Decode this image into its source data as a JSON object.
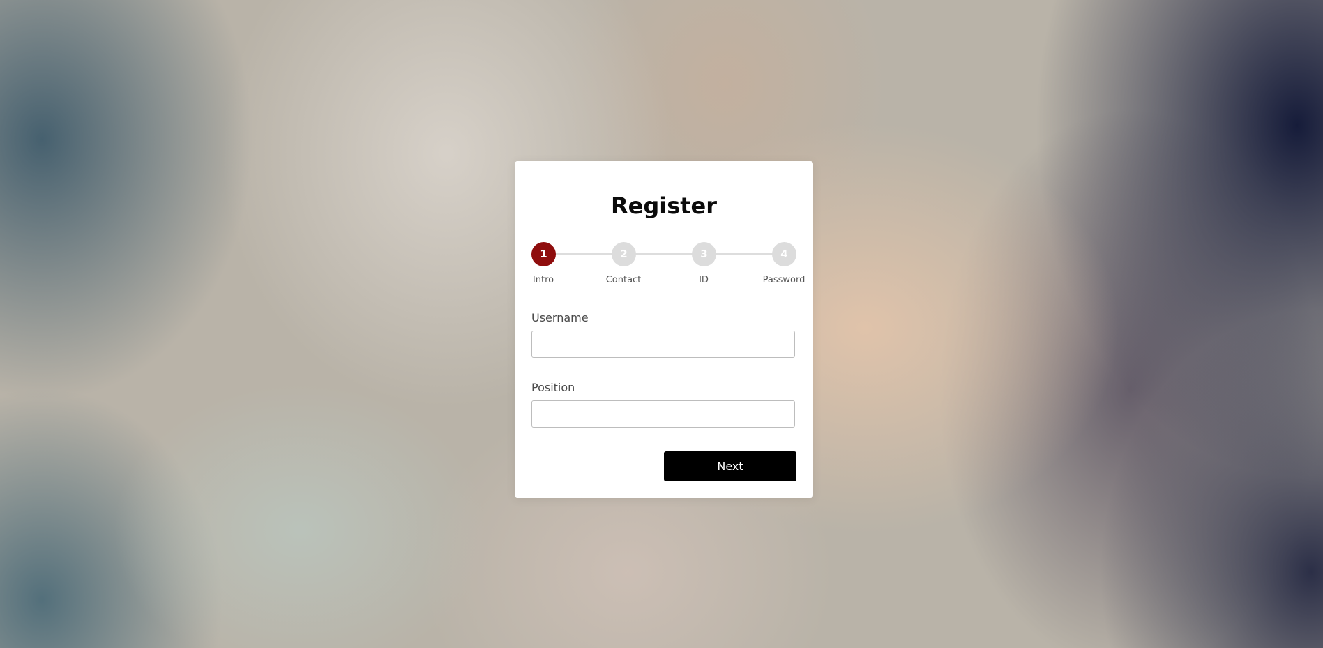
{
  "form": {
    "title": "Register",
    "steps": [
      {
        "number": "1",
        "label": "Intro",
        "active": true
      },
      {
        "number": "2",
        "label": "Contact",
        "active": false
      },
      {
        "number": "3",
        "label": "ID",
        "active": false
      },
      {
        "number": "4",
        "label": "Password",
        "active": false
      }
    ],
    "fields": {
      "username": {
        "label": "Username",
        "value": "",
        "placeholder": ""
      },
      "position": {
        "label": "Position",
        "value": "",
        "placeholder": ""
      }
    },
    "next_label": "Next"
  },
  "colors": {
    "active_step": "#8f0d0d",
    "inactive_step": "#dcdcdc",
    "button": "#000000"
  }
}
